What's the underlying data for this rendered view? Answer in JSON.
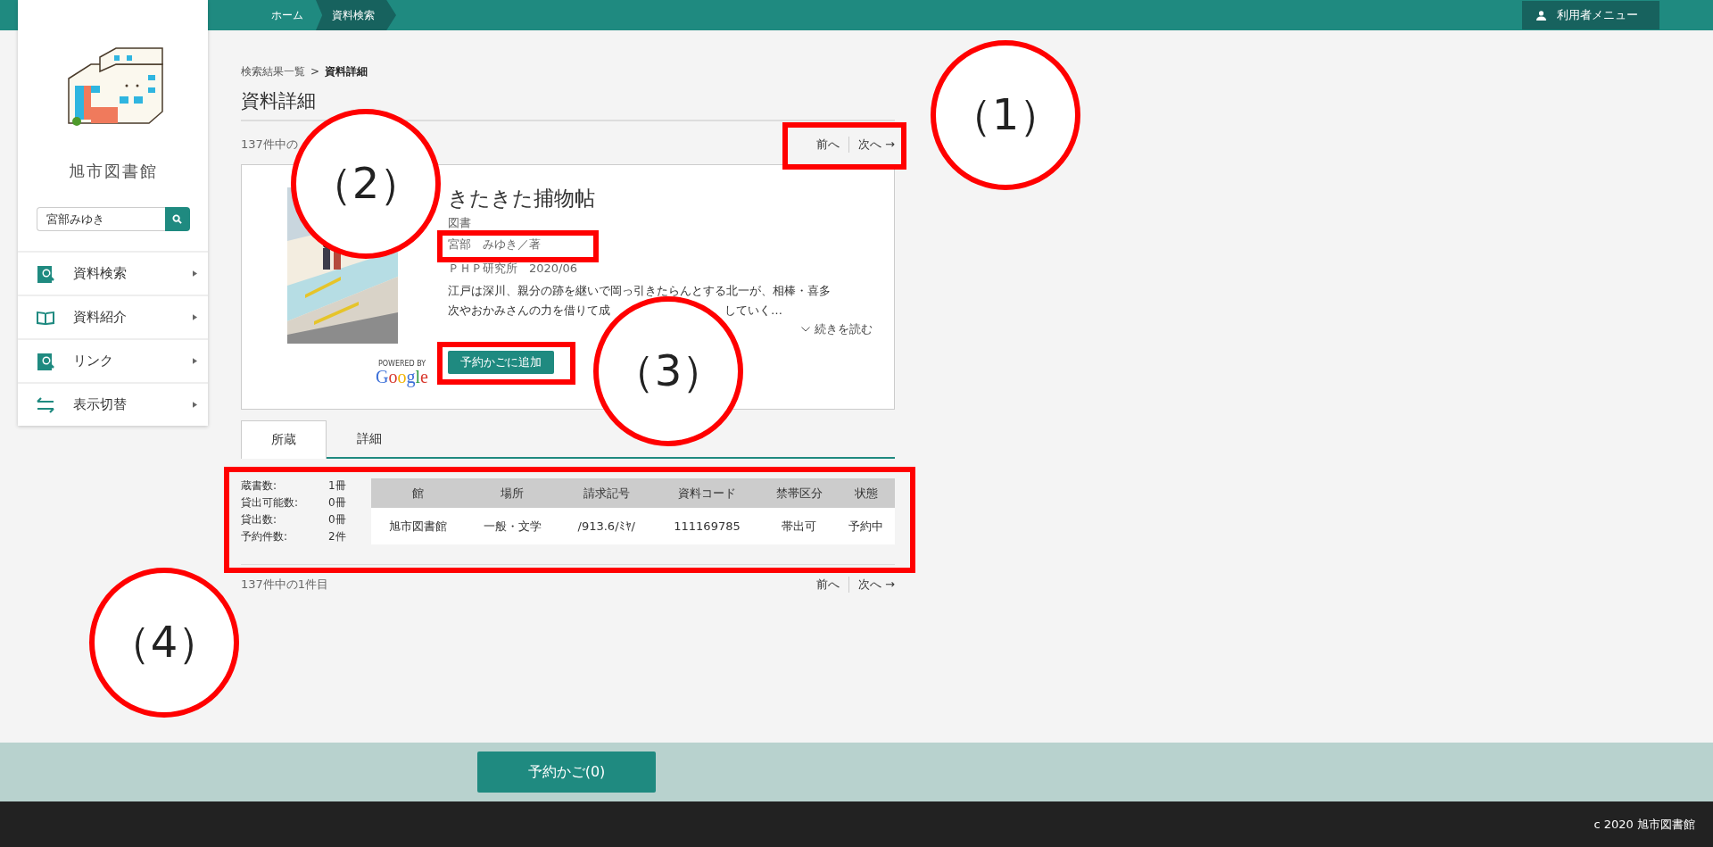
{
  "top_bar": {
    "breadcrumbs": [
      {
        "label": "ホーム",
        "selected": false
      },
      {
        "label": "資料検索",
        "selected": true
      }
    ],
    "user_menu": "利用者メニュー"
  },
  "sidebar": {
    "library_name": "旭市図書館",
    "search": {
      "value": "宮部みゆき"
    },
    "menu": [
      {
        "label": "資料検索",
        "kind": "search"
      },
      {
        "label": "資料紹介",
        "kind": "book"
      },
      {
        "label": "リンク",
        "kind": "search"
      },
      {
        "label": "表示切替",
        "kind": "swap"
      }
    ]
  },
  "breadcrumb": [
    {
      "label": "検索結果一覧",
      "current": false
    },
    {
      "label": "資料詳細",
      "current": true
    }
  ],
  "breadcrumb_separator": ">",
  "heading": "資料詳細",
  "result_count_top": "137件中の",
  "pager_top": {
    "prev": "前へ",
    "next": "次へ →"
  },
  "book": {
    "title": "きたきた捕物帖",
    "type": "図書",
    "author": "宮部　みゆき／著",
    "publisher": "ＰＨＰ研究所　2020/06",
    "description": [
      "江戸は深川、親分の跡を継いで岡っ引きたらんとする北一が、相棒・喜多",
      "次やおかみさんの力を借りて成",
      "していく…"
    ],
    "read_more": "続きを読む",
    "powered_by": "POWERED BY",
    "google": "Google",
    "add_button": "予約かごに追加"
  },
  "tabs": [
    {
      "label": "所蔵",
      "selected": true
    },
    {
      "label": "詳細",
      "selected": false
    }
  ],
  "summary": [
    {
      "label": "蔵書数:",
      "value": "1冊"
    },
    {
      "label": "貸出可能数:",
      "value": "0冊"
    },
    {
      "label": "貸出数:",
      "value": "0冊"
    },
    {
      "label": "予約件数:",
      "value": "2件"
    }
  ],
  "holdings": {
    "columns": [
      "館",
      "場所",
      "請求記号",
      "資料コード",
      "禁帯区分",
      "状態"
    ],
    "rows": [
      [
        "旭市図書館",
        "一般・文学",
        "/913.6/ﾐﾔ/",
        "111169785",
        "帯出可",
        "予約中"
      ]
    ]
  },
  "result_count_bottom": "137件中の1件目",
  "pager_bottom": {
    "prev": "前へ",
    "next": "次へ →"
  },
  "cart_button": "予約かご(0)",
  "copyright": "c 2020 旭市図書館",
  "annotations": [
    {
      "label": "（1）"
    },
    {
      "label": "（2）"
    },
    {
      "label": "（3）"
    },
    {
      "label": "（4）"
    }
  ]
}
